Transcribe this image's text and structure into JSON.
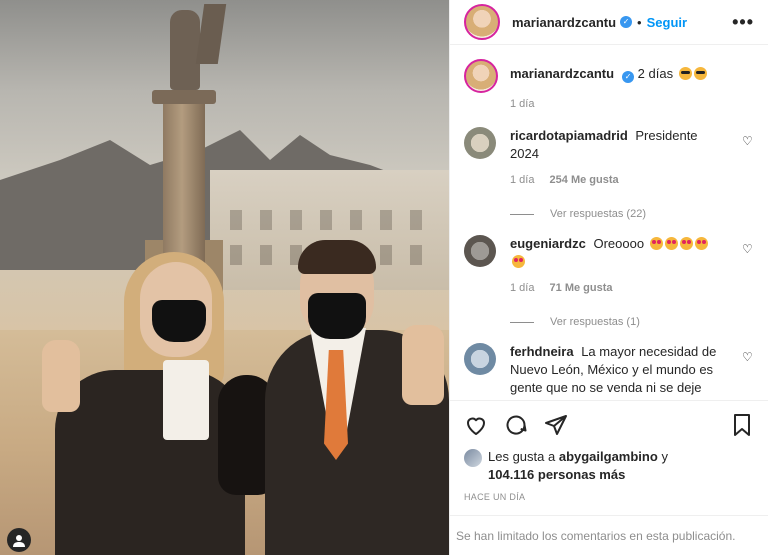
{
  "header": {
    "username": "marianardzcantu",
    "separator": "•",
    "follow_label": "Seguir",
    "more_label": "•••"
  },
  "caption": {
    "username": "marianardzcantu",
    "text": "2 días",
    "time": "1 día"
  },
  "comments": [
    {
      "username": "ricardotapiamadrid",
      "text": "Presidente 2024",
      "time": "1 día",
      "likes": "254 Me gusta",
      "replies": "Ver respuestas (22)"
    },
    {
      "username": "eugeniardzc",
      "text": "Oreoooo",
      "time": "1 día",
      "likes": "71 Me gusta",
      "replies": "Ver respuestas (1)"
    },
    {
      "username": "ferhdneira",
      "text": "La mayor necesidad de Nuevo León, México y el mundo es gente que no se venda ni se deje"
    }
  ],
  "likes": {
    "prefix": "Les gusta a",
    "user": "abygailgambino",
    "conj": "y",
    "count": "104.116 personas más"
  },
  "timestamp": "HACE UN DÍA",
  "comments_disabled": "Se han limitado los comentarios en esta publicación.",
  "icons": {
    "verified": "verified-badge-icon",
    "heart": "heart-icon",
    "comment": "comment-icon",
    "share": "paper-plane-icon",
    "save": "bookmark-icon",
    "user_tag": "user-tag-icon"
  },
  "colors": {
    "link": "#0095f6",
    "verified": "#3897f0",
    "muted": "#8e8e8e",
    "text": "#262626"
  }
}
